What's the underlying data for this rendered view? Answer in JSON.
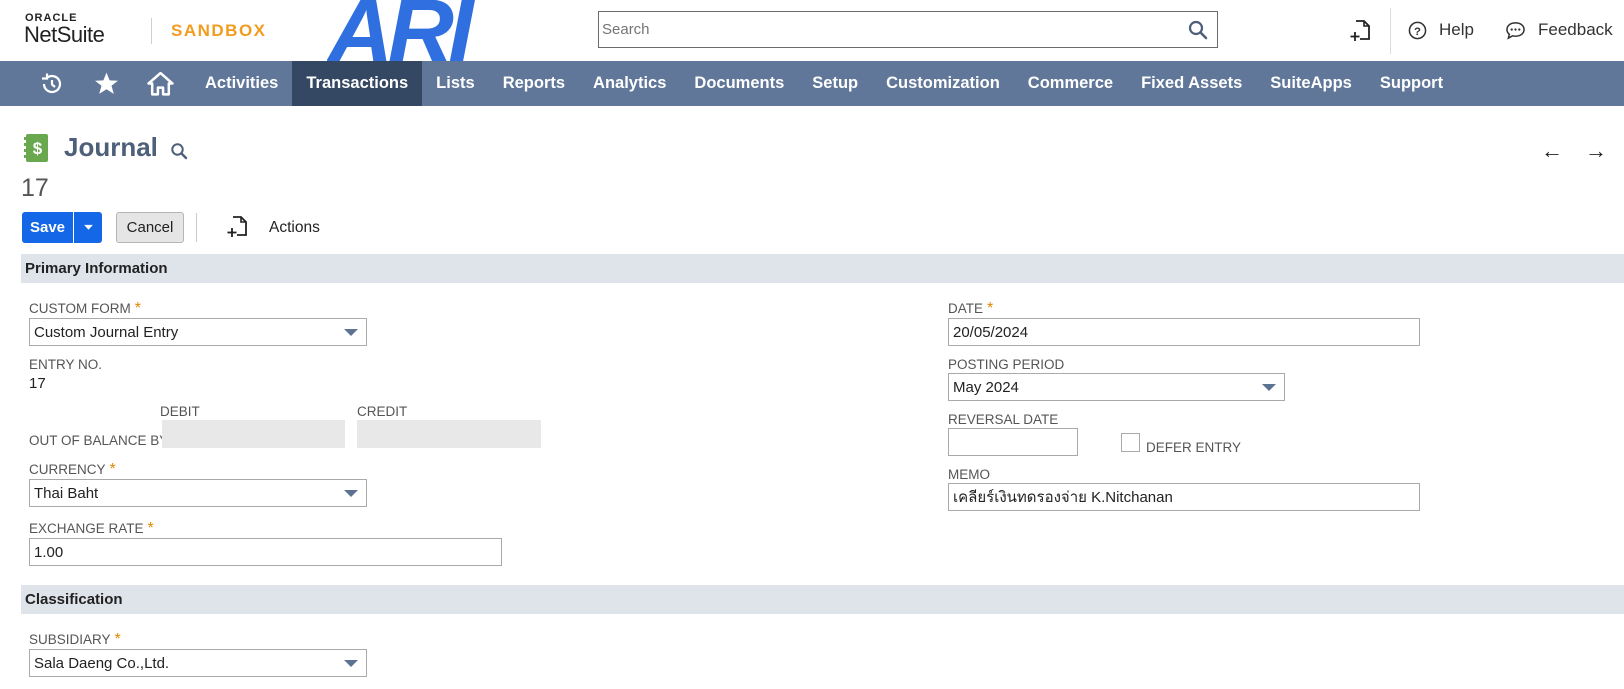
{
  "header": {
    "logo_oracle": "ORACLE",
    "logo_netsuite": "NetSuite",
    "environment": "SANDBOX",
    "company_logo": "ARI",
    "search_placeholder": "Search",
    "help_label": "Help",
    "feedback_label": "Feedback"
  },
  "nav": {
    "items": [
      {
        "label": "Activities"
      },
      {
        "label": "Transactions"
      },
      {
        "label": "Lists"
      },
      {
        "label": "Reports"
      },
      {
        "label": "Analytics"
      },
      {
        "label": "Documents"
      },
      {
        "label": "Setup"
      },
      {
        "label": "Customization"
      },
      {
        "label": "Commerce"
      },
      {
        "label": "Fixed Assets"
      },
      {
        "label": "SuiteApps"
      },
      {
        "label": "Support"
      }
    ],
    "active": "Transactions"
  },
  "page": {
    "title": "Journal",
    "record_number": "17",
    "prev_arrow": "←",
    "next_arrow": "→"
  },
  "toolbar": {
    "save_label": "Save",
    "cancel_label": "Cancel",
    "actions_label": "Actions"
  },
  "primary": {
    "section_title": "Primary Information",
    "custom_form_label": "CUSTOM FORM",
    "custom_form_value": "Custom Journal Entry",
    "entry_no_label": "ENTRY NO.",
    "entry_no_value": "17",
    "debit_label": "DEBIT",
    "credit_label": "CREDIT",
    "out_of_balance_label": "OUT OF BALANCE BY",
    "currency_label": "CURRENCY",
    "currency_value": "Thai Baht",
    "exchange_rate_label": "EXCHANGE RATE",
    "exchange_rate_value": "1.00",
    "date_label": "DATE",
    "date_value": "20/05/2024",
    "posting_period_label": "POSTING PERIOD",
    "posting_period_value": "May 2024",
    "reversal_date_label": "REVERSAL DATE",
    "reversal_date_value": "",
    "defer_entry_label": "DEFER ENTRY",
    "memo_label": "MEMO",
    "memo_value": "เคลียร์เงินทดรองจ่าย K.Nitchanan",
    "required_mark": "*"
  },
  "classification": {
    "section_title": "Classification",
    "subsidiary_label": "SUBSIDIARY",
    "subsidiary_value": "Sala Daeng Co.,Ltd."
  },
  "colors": {
    "nav_bg": "#607799",
    "nav_active": "#344863",
    "save_button": "#1467e6",
    "sandbox": "#f29c1f",
    "brand_logo": "#2f6fe0",
    "section_bar": "#dfe4eb",
    "required": "#e08a00"
  }
}
